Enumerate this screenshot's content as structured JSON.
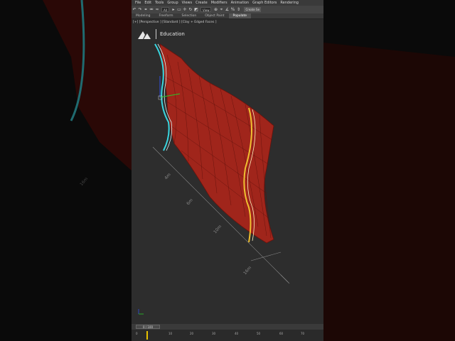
{
  "menu": [
    "File",
    "Edit",
    "Tools",
    "Group",
    "Views",
    "Create",
    "Modifiers",
    "Animation",
    "Graph Editors",
    "Rendering"
  ],
  "toolbar": {
    "icons": [
      "undo-icon",
      "redo-icon",
      "link-icon",
      "unlink-icon",
      "bind-icon",
      "select-icon"
    ],
    "filter_value": "All",
    "view_value": "View",
    "create_selection_label": "Create Se"
  },
  "ribbon_tabs": [
    "Modeling",
    "Freeform",
    "Selection",
    "Object Paint",
    "Populate"
  ],
  "active_tab": "Populate",
  "viewport_label": "[+] [Perspective ] [Standard ] [Clay + Edged Faces ]",
  "logo_text": "Education",
  "frame_slider": "0 / 100",
  "timeline_ticks": [
    "0",
    "10",
    "20",
    "30",
    "40",
    "50",
    "60",
    "70"
  ],
  "dimension_labels": [
    "4m",
    "6m",
    "10m",
    "16m"
  ],
  "colors": {
    "surface": "#a0251b",
    "spline_left": "#39d6e0",
    "spline_right": "#f0c030",
    "viewport_bg": "#2d2d2d"
  }
}
